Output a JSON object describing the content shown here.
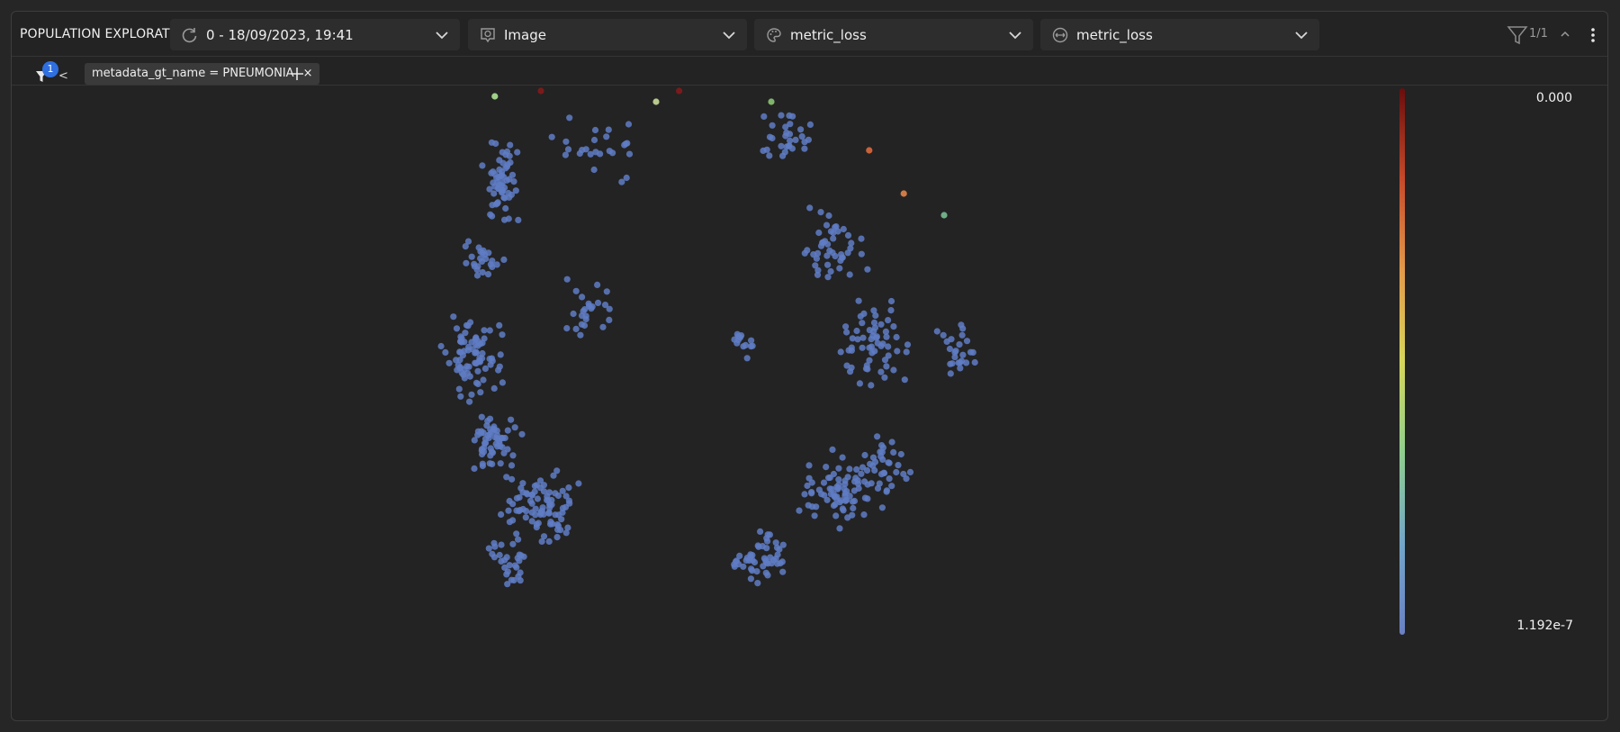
{
  "header": {
    "title": "POPULATION EXPLORATION",
    "session_select": {
      "value": "0 - 18/09/2023, 19:41",
      "icon": "refresh-icon"
    },
    "visual_select": {
      "value": "Image",
      "icon": "image-visualizer-icon"
    },
    "color_select": {
      "value": "metric_loss",
      "icon": "palette-icon"
    },
    "size_select": {
      "value": "metric_loss",
      "icon": "size-icon"
    },
    "filter_count": "1/1"
  },
  "filters": {
    "badge_count": "1",
    "collapse_label": "<",
    "active": [
      {
        "label": "metadata_gt_name = PNEUMONIA"
      }
    ],
    "remove_label": "×",
    "add_label": "+"
  },
  "colorbar": {
    "max_label": "0.000",
    "min_label": "1.192e-7",
    "colors": [
      "#6a0d0d",
      "#c64a2a",
      "#e39a4a",
      "#d6d65a",
      "#8fcf8e",
      "#73a6c9",
      "#6a80c4"
    ]
  },
  "chart_data": {
    "type": "scatter",
    "point_color": "#5f7cc4",
    "highlight_points": [
      {
        "x": 0.12,
        "y": 0.98,
        "color": "#9fcf88"
      },
      {
        "x": 0.4,
        "y": 0.97,
        "color": "#b7c98d"
      },
      {
        "x": 0.6,
        "y": 0.97,
        "color": "#7fb56a"
      },
      {
        "x": 0.77,
        "y": 0.88,
        "color": "#c9623a"
      },
      {
        "x": 0.83,
        "y": 0.8,
        "color": "#d07a45"
      },
      {
        "x": 0.9,
        "y": 0.76,
        "color": "#6fae86"
      },
      {
        "x": 0.44,
        "y": 0.99,
        "color": "#7a1a1a"
      },
      {
        "x": 0.2,
        "y": 0.99,
        "color": "#7a1a1a"
      }
    ],
    "clusters": [
      {
        "cx": 0.13,
        "cy": 0.82,
        "rx": 0.05,
        "ry": 0.1,
        "n": 60
      },
      {
        "cx": 0.1,
        "cy": 0.68,
        "rx": 0.04,
        "ry": 0.05,
        "n": 25
      },
      {
        "cx": 0.08,
        "cy": 0.5,
        "rx": 0.07,
        "ry": 0.09,
        "n": 80
      },
      {
        "cx": 0.12,
        "cy": 0.34,
        "rx": 0.06,
        "ry": 0.08,
        "n": 60
      },
      {
        "cx": 0.2,
        "cy": 0.22,
        "rx": 0.08,
        "ry": 0.09,
        "n": 85
      },
      {
        "cx": 0.15,
        "cy": 0.12,
        "rx": 0.05,
        "ry": 0.07,
        "n": 30
      },
      {
        "cx": 0.3,
        "cy": 0.88,
        "rx": 0.1,
        "ry": 0.07,
        "n": 25
      },
      {
        "cx": 0.28,
        "cy": 0.58,
        "rx": 0.07,
        "ry": 0.1,
        "n": 25
      },
      {
        "cx": 0.55,
        "cy": 0.52,
        "rx": 0.03,
        "ry": 0.04,
        "n": 14
      },
      {
        "cx": 0.62,
        "cy": 0.9,
        "rx": 0.07,
        "ry": 0.06,
        "n": 30
      },
      {
        "cx": 0.7,
        "cy": 0.7,
        "rx": 0.08,
        "ry": 0.1,
        "n": 45
      },
      {
        "cx": 0.78,
        "cy": 0.52,
        "rx": 0.09,
        "ry": 0.12,
        "n": 60
      },
      {
        "cx": 0.93,
        "cy": 0.5,
        "rx": 0.05,
        "ry": 0.08,
        "n": 25
      },
      {
        "cx": 0.72,
        "cy": 0.25,
        "rx": 0.09,
        "ry": 0.09,
        "n": 80
      },
      {
        "cx": 0.58,
        "cy": 0.13,
        "rx": 0.06,
        "ry": 0.06,
        "n": 50
      },
      {
        "cx": 0.8,
        "cy": 0.3,
        "rx": 0.05,
        "ry": 0.08,
        "n": 30
      }
    ]
  }
}
